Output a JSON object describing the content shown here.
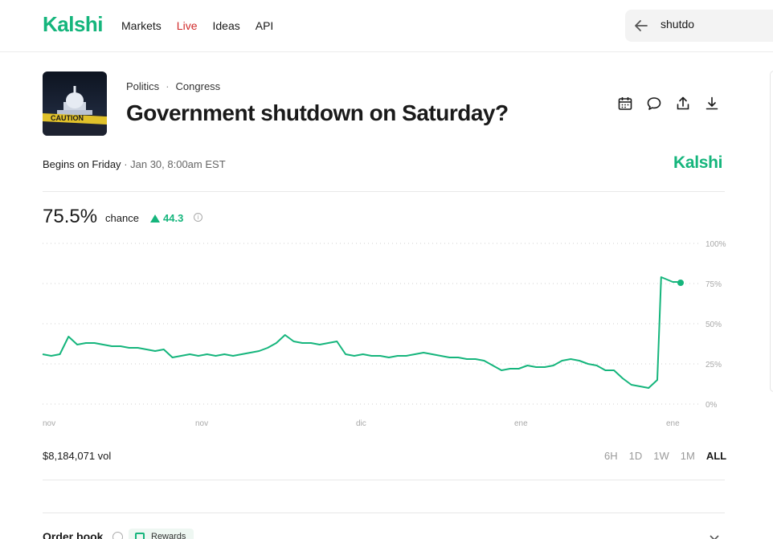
{
  "header": {
    "logo": "Kalshi",
    "nav": [
      "Markets",
      "Live",
      "Ideas",
      "API"
    ],
    "search_value": "shutdo"
  },
  "market": {
    "breadcrumb": [
      "Politics",
      "Congress"
    ],
    "title": "Government shutdown on Saturday?",
    "thumbnail_text": "CAUTION",
    "begins_label": "Begins on Friday",
    "begins_date": "· Jan 30, 8:00am EST",
    "brand": "Kalshi",
    "chance_value": "75.5%",
    "chance_label": "chance",
    "chance_delta": "44.3",
    "volume": "$8,184,071 vol",
    "ranges": [
      "6H",
      "1D",
      "1W",
      "1M",
      "ALL"
    ],
    "active_range": "ALL"
  },
  "icons": [
    "arrow-left-icon",
    "calendar-icon",
    "comment-icon",
    "share-icon",
    "download-icon",
    "info-icon",
    "gift-icon",
    "chevron-down-icon"
  ],
  "colors": {
    "accent": "#15b57c",
    "live": "#d12a2a"
  },
  "orderbook": {
    "label": "Order book",
    "rewards_label": "Rewards"
  },
  "chart_data": {
    "type": "line",
    "x_tick_labels": [
      "nov",
      "nov",
      "dic",
      "ene",
      "ene"
    ],
    "y_tick_labels": [
      "100%",
      "75%",
      "50%",
      "25%",
      "0%"
    ],
    "ylim": [
      0,
      100
    ],
    "grid": true,
    "series": [
      {
        "values": [
          31,
          30,
          31,
          42,
          37,
          38,
          38,
          37,
          36,
          36,
          35,
          35,
          34,
          33,
          34,
          29,
          30,
          31,
          30,
          31,
          30,
          31,
          30,
          31,
          32,
          33,
          35,
          38,
          43,
          39,
          38,
          38,
          37,
          38,
          39,
          31,
          30,
          31,
          30,
          30,
          29,
          30,
          30,
          31,
          32,
          31,
          30,
          29,
          29,
          28,
          28,
          27,
          24,
          21,
          22,
          22,
          24,
          23,
          23,
          24,
          27,
          28,
          27,
          25,
          24,
          21,
          21,
          16,
          12,
          11,
          10,
          15,
          79,
          78,
          77,
          76,
          76,
          75.5
        ]
      }
    ]
  }
}
